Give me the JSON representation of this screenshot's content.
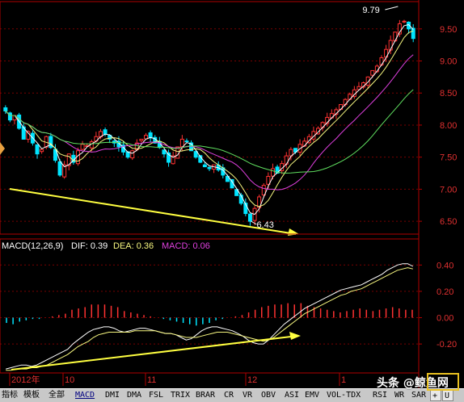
{
  "chart_data": [
    {
      "type": "candlestick",
      "panel": "price",
      "ylim": [
        6.3,
        9.85
      ],
      "y_ticks": [
        "9.50",
        "9.00",
        "8.50",
        "8.00",
        "7.50",
        "7.00",
        "6.50"
      ],
      "y_tick_values": [
        9.5,
        9.0,
        8.5,
        8.0,
        7.5,
        7.0,
        6.5
      ],
      "annotations": [
        {
          "text": "9.79",
          "value": 9.79
        },
        {
          "text": "6.43",
          "value": 6.43
        }
      ],
      "closes": [
        8.22,
        8.08,
        8.15,
        7.95,
        7.78,
        7.9,
        7.72,
        7.55,
        7.62,
        7.82,
        7.65,
        7.45,
        7.22,
        7.38,
        7.55,
        7.42,
        7.6,
        7.7,
        7.68,
        7.74,
        7.82,
        7.9,
        7.86,
        7.78,
        7.72,
        7.66,
        7.58,
        7.5,
        7.6,
        7.72,
        7.78,
        7.84,
        7.8,
        7.72,
        7.65,
        7.55,
        7.42,
        7.52,
        7.66,
        7.78,
        7.74,
        7.6,
        7.5,
        7.42,
        7.35,
        7.32,
        7.38,
        7.3,
        7.22,
        7.12,
        7.02,
        6.9,
        6.78,
        6.62,
        6.5,
        6.7,
        6.88,
        7.06,
        7.2,
        7.32,
        7.25,
        7.4,
        7.52,
        7.62,
        7.58,
        7.7,
        7.75,
        7.82,
        7.9,
        7.95,
        8.04,
        8.12,
        8.18,
        8.24,
        8.32,
        8.4,
        8.48,
        8.55,
        8.6,
        8.66,
        8.75,
        8.85,
        8.92,
        9.05,
        9.18,
        9.32,
        9.45,
        9.58,
        9.62,
        9.5,
        9.35
      ],
      "low_point": 6.43,
      "high_point": 9.79,
      "moving_averages": [
        "white",
        "yellow",
        "magenta",
        "green"
      ]
    },
    {
      "type": "line",
      "panel": "macd",
      "title": "MACD(12,26,9)",
      "dif_label": "DIF: 0.39",
      "dea_label": "DEA: 0.36",
      "macd_label": "MACD: 0.06",
      "ylim": [
        -0.42,
        0.5
      ],
      "y_ticks": [
        "0.40",
        "0.20",
        "0.00",
        "-0.20"
      ],
      "y_tick_values": [
        0.4,
        0.2,
        0.0,
        -0.2
      ],
      "series": [
        {
          "name": "DIF",
          "values": [
            -0.39,
            -0.38,
            -0.37,
            -0.36,
            -0.36,
            -0.37,
            -0.36,
            -0.34,
            -0.32,
            -0.3,
            -0.28,
            -0.26,
            -0.24,
            -0.2,
            -0.17,
            -0.14,
            -0.11,
            -0.09,
            -0.08,
            -0.07,
            -0.07,
            -0.08,
            -0.1,
            -0.11,
            -0.1,
            -0.09,
            -0.08,
            -0.08,
            -0.09,
            -0.1,
            -0.11,
            -0.12,
            -0.12,
            -0.13,
            -0.15,
            -0.17,
            -0.16,
            -0.13,
            -0.1,
            -0.08,
            -0.07,
            -0.07,
            -0.08,
            -0.09,
            -0.1,
            -0.12,
            -0.14,
            -0.17,
            -0.19,
            -0.2,
            -0.2,
            -0.17,
            -0.13,
            -0.09,
            -0.05,
            -0.02,
            0.01,
            0.04,
            0.07,
            0.09,
            0.11,
            0.13,
            0.15,
            0.17,
            0.19,
            0.21,
            0.22,
            0.23,
            0.24,
            0.25,
            0.27,
            0.29,
            0.31,
            0.33,
            0.36,
            0.38,
            0.4,
            0.41,
            0.41,
            0.39
          ]
        },
        {
          "name": "DEA",
          "values": [
            -0.4,
            -0.4,
            -0.39,
            -0.39,
            -0.39,
            -0.38,
            -0.38,
            -0.37,
            -0.36,
            -0.34,
            -0.32,
            -0.3,
            -0.28,
            -0.25,
            -0.22,
            -0.2,
            -0.18,
            -0.15,
            -0.13,
            -0.12,
            -0.11,
            -0.11,
            -0.11,
            -0.11,
            -0.11,
            -0.1,
            -0.1,
            -0.1,
            -0.1,
            -0.1,
            -0.11,
            -0.12,
            -0.12,
            -0.13,
            -0.14,
            -0.15,
            -0.15,
            -0.15,
            -0.14,
            -0.13,
            -0.12,
            -0.11,
            -0.11,
            -0.11,
            -0.12,
            -0.13,
            -0.14,
            -0.15,
            -0.16,
            -0.17,
            -0.18,
            -0.17,
            -0.15,
            -0.12,
            -0.09,
            -0.06,
            -0.03,
            0.0,
            0.03,
            0.05,
            0.07,
            0.09,
            0.11,
            0.13,
            0.15,
            0.17,
            0.18,
            0.2,
            0.21,
            0.22,
            0.24,
            0.26,
            0.28,
            0.3,
            0.32,
            0.34,
            0.36,
            0.37,
            0.38,
            0.37
          ]
        },
        {
          "name": "MACD",
          "values": [
            -0.04,
            -0.05,
            -0.03,
            -0.02,
            -0.01,
            -0.01,
            0.0,
            0.01,
            0.02,
            0.03,
            0.06,
            0.07,
            0.08,
            0.1,
            0.1,
            0.1,
            0.09,
            0.08,
            0.05,
            0.04,
            0.03,
            0.02,
            0.01,
            0.0,
            -0.01,
            -0.02,
            -0.03,
            -0.04,
            -0.05,
            -0.06,
            -0.05,
            -0.04,
            -0.02,
            -0.01,
            0.0,
            0.01,
            0.02,
            0.04,
            0.06,
            0.08,
            0.09,
            0.1,
            0.1,
            0.11,
            0.1,
            0.11,
            0.09,
            0.08,
            0.07,
            0.06,
            0.05,
            0.04,
            0.05,
            0.06,
            0.07,
            0.06,
            0.05,
            0.06,
            0.07,
            0.08,
            0.07,
            0.06,
            0.06
          ]
        }
      ]
    }
  ],
  "x_axis": {
    "labels": [
      "2012年",
      "10",
      "11",
      "12",
      "1"
    ],
    "label_values": [
      "2012年",
      "10",
      "11",
      "12",
      "1"
    ]
  },
  "tabs": [
    {
      "label": "指标"
    },
    {
      "label": "模板"
    },
    {
      "label": "全部"
    },
    {
      "label": "MACD"
    },
    {
      "label": "DMI"
    },
    {
      "label": "DMA"
    },
    {
      "label": "FSL"
    },
    {
      "label": "TRIX"
    },
    {
      "label": "BRAR"
    },
    {
      "label": "CR"
    },
    {
      "label": "VR"
    },
    {
      "label": "OBV"
    },
    {
      "label": "ASI"
    },
    {
      "label": "EMV"
    },
    {
      "label": "VOL-TDX"
    },
    {
      "label": "RSI"
    },
    {
      "label": "WR"
    },
    {
      "label": "SAR"
    },
    {
      "label": "+"
    },
    {
      "label": "U"
    }
  ],
  "watermark": "头条 @鲸鱼网",
  "colors": {
    "up": "#ff3232",
    "down": "#00e5ff",
    "axis": "#b00000",
    "grid": "#7a0000",
    "ma_white": "#ffffff",
    "ma_yellow": "#f8f880",
    "ma_magenta": "#e040e0",
    "ma_green": "#60e060",
    "trend": "#ffff40",
    "dif": "#ffffff",
    "dea": "#f8f880",
    "macd_label": "#e040e0"
  }
}
